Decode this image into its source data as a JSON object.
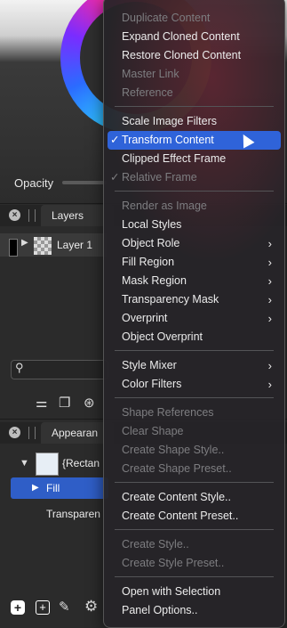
{
  "background": {
    "opacity_label": "Opacity",
    "layers_tab": "Layers",
    "layer_name": "Layer 1",
    "appearance_tab": "Appearan",
    "appearance_title": "{Rectan",
    "fill_label": "Fill",
    "transparency_label": "Transparen",
    "icons": [
      "add-icon",
      "add-square-icon",
      "add-brush-icon",
      "settings-gear-icon"
    ]
  },
  "menu": {
    "accent_color": "#2f63d9",
    "items": [
      {
        "label": "Duplicate Content",
        "enabled": true
      },
      {
        "label": "Expand Cloned Content",
        "enabled": true
      },
      {
        "label": "Restore Cloned Content",
        "enabled": true
      },
      {
        "label": "Master Link",
        "enabled": false
      },
      {
        "label": "Reference",
        "enabled": false
      },
      {
        "label": "Scale Image Filters",
        "enabled": true
      },
      {
        "label": "Transform Content",
        "enabled": true,
        "checked": true,
        "highlighted": true
      },
      {
        "label": "Clipped Effect Frame",
        "enabled": true
      },
      {
        "label": "Relative Frame",
        "enabled": false,
        "checked": true
      },
      {
        "label": "Render as Image",
        "enabled": false
      },
      {
        "label": "Local Styles",
        "enabled": true
      },
      {
        "label": "Object Role",
        "enabled": true,
        "submenu": true
      },
      {
        "label": "Fill Region",
        "enabled": true,
        "submenu": true
      },
      {
        "label": "Mask Region",
        "enabled": true,
        "submenu": true
      },
      {
        "label": "Transparency Mask",
        "enabled": true,
        "submenu": true
      },
      {
        "label": "Overprint",
        "enabled": true,
        "submenu": true
      },
      {
        "label": "Object Overprint",
        "enabled": true
      },
      {
        "label": "Style Mixer",
        "enabled": true,
        "submenu": true
      },
      {
        "label": "Color Filters",
        "enabled": true,
        "submenu": true
      },
      {
        "label": "Shape References",
        "enabled": false
      },
      {
        "label": "Clear Shape",
        "enabled": false
      },
      {
        "label": "Create Shape Style..",
        "enabled": false
      },
      {
        "label": "Create Shape Preset..",
        "enabled": false
      },
      {
        "label": "Create Content Style..",
        "enabled": true
      },
      {
        "label": "Create Content Preset..",
        "enabled": true
      },
      {
        "label": "Create Style..",
        "enabled": false
      },
      {
        "label": "Create Style Preset..",
        "enabled": false
      },
      {
        "label": "Open with Selection",
        "enabled": true
      },
      {
        "label": "Panel Options..",
        "enabled": true
      }
    ]
  }
}
